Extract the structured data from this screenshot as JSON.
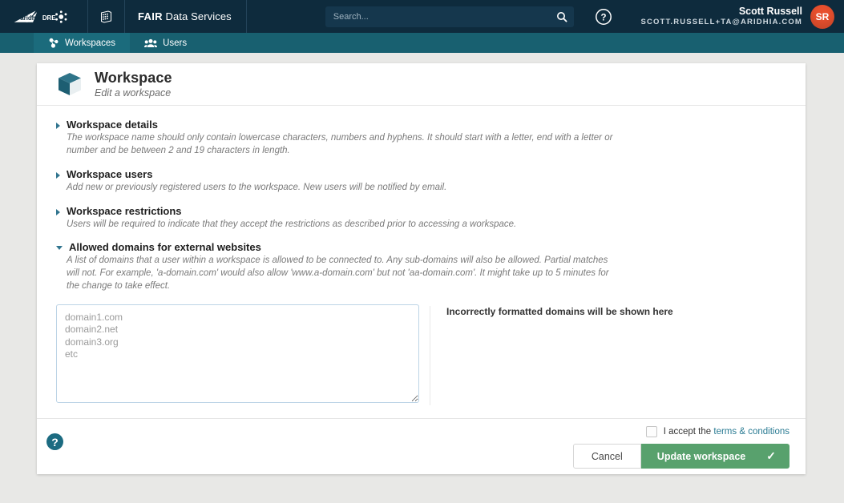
{
  "header": {
    "logo_text": "aridhia DRE",
    "apps_icon": "apps-grid-icon",
    "brand_bold": "FAIR",
    "brand_rest": "Data Services",
    "search": {
      "placeholder": "Search...",
      "value": "",
      "icon": "search-icon"
    },
    "help_icon": "help-circle-icon",
    "user": {
      "name": "Scott Russell",
      "email": "SCOTT.RUSSELL+TA@ARIDHIA.COM",
      "initials": "SR",
      "avatar_color": "#e8502e"
    }
  },
  "nav": {
    "items": [
      {
        "label": "Workspaces",
        "icon": "workspaces-icon",
        "active": true
      },
      {
        "label": "Users",
        "icon": "users-icon",
        "active": false
      }
    ]
  },
  "card": {
    "icon": "cube-icon",
    "title": "Workspace",
    "subtitle": "Edit a workspace",
    "sections": [
      {
        "title": "Workspace details",
        "expanded": false,
        "description": "The workspace name should only contain lowercase characters, numbers and hyphens. It should start with a letter, end with a letter or number and be between 2 and 19 characters in length."
      },
      {
        "title": "Workspace users",
        "expanded": false,
        "description": "Add new or previously registered users to the workspace. New users will be notified by email."
      },
      {
        "title": "Workspace restrictions",
        "expanded": false,
        "description": "Users will be required to indicate that they accept the restrictions as described prior to accessing a workspace."
      },
      {
        "title": "Allowed domains for external websites",
        "expanded": true,
        "description": "A list of domains that a user within a workspace is allowed to be connected to. Any sub-domains will also be allowed. Partial matches will not. For example, 'a-domain.com' would also allow 'www.a-domain.com' but not 'aa-domain.com'. It might take up to 5 minutes for the change to take effect."
      }
    ],
    "domains": {
      "textarea_value": "",
      "textarea_placeholder": "domain1.com\ndomain2.net\ndomain3.org\netc",
      "errors_label": "Incorrectly formatted domains will be shown here"
    }
  },
  "footer": {
    "help_icon": "help-circle-icon",
    "accept_prefix": "I accept the",
    "accept_link": "terms & conditions",
    "accept_checked": false,
    "cancel_label": "Cancel",
    "update_label": "Update workspace",
    "update_icon": "check-icon",
    "update_color": "#58a16d"
  }
}
